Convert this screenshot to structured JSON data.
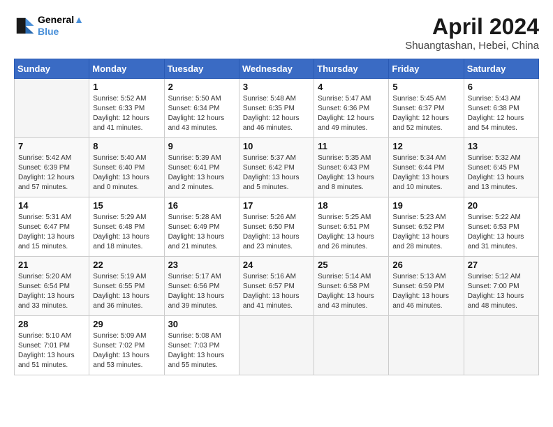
{
  "header": {
    "logo_line1": "General",
    "logo_line2": "Blue",
    "month_title": "April 2024",
    "subtitle": "Shuangtashan, Hebei, China"
  },
  "weekdays": [
    "Sunday",
    "Monday",
    "Tuesday",
    "Wednesday",
    "Thursday",
    "Friday",
    "Saturday"
  ],
  "weeks": [
    [
      {
        "day": "",
        "info": ""
      },
      {
        "day": "1",
        "info": "Sunrise: 5:52 AM\nSunset: 6:33 PM\nDaylight: 12 hours\nand 41 minutes."
      },
      {
        "day": "2",
        "info": "Sunrise: 5:50 AM\nSunset: 6:34 PM\nDaylight: 12 hours\nand 43 minutes."
      },
      {
        "day": "3",
        "info": "Sunrise: 5:48 AM\nSunset: 6:35 PM\nDaylight: 12 hours\nand 46 minutes."
      },
      {
        "day": "4",
        "info": "Sunrise: 5:47 AM\nSunset: 6:36 PM\nDaylight: 12 hours\nand 49 minutes."
      },
      {
        "day": "5",
        "info": "Sunrise: 5:45 AM\nSunset: 6:37 PM\nDaylight: 12 hours\nand 52 minutes."
      },
      {
        "day": "6",
        "info": "Sunrise: 5:43 AM\nSunset: 6:38 PM\nDaylight: 12 hours\nand 54 minutes."
      }
    ],
    [
      {
        "day": "7",
        "info": "Sunrise: 5:42 AM\nSunset: 6:39 PM\nDaylight: 12 hours\nand 57 minutes."
      },
      {
        "day": "8",
        "info": "Sunrise: 5:40 AM\nSunset: 6:40 PM\nDaylight: 13 hours\nand 0 minutes."
      },
      {
        "day": "9",
        "info": "Sunrise: 5:39 AM\nSunset: 6:41 PM\nDaylight: 13 hours\nand 2 minutes."
      },
      {
        "day": "10",
        "info": "Sunrise: 5:37 AM\nSunset: 6:42 PM\nDaylight: 13 hours\nand 5 minutes."
      },
      {
        "day": "11",
        "info": "Sunrise: 5:35 AM\nSunset: 6:43 PM\nDaylight: 13 hours\nand 8 minutes."
      },
      {
        "day": "12",
        "info": "Sunrise: 5:34 AM\nSunset: 6:44 PM\nDaylight: 13 hours\nand 10 minutes."
      },
      {
        "day": "13",
        "info": "Sunrise: 5:32 AM\nSunset: 6:45 PM\nDaylight: 13 hours\nand 13 minutes."
      }
    ],
    [
      {
        "day": "14",
        "info": "Sunrise: 5:31 AM\nSunset: 6:47 PM\nDaylight: 13 hours\nand 15 minutes."
      },
      {
        "day": "15",
        "info": "Sunrise: 5:29 AM\nSunset: 6:48 PM\nDaylight: 13 hours\nand 18 minutes."
      },
      {
        "day": "16",
        "info": "Sunrise: 5:28 AM\nSunset: 6:49 PM\nDaylight: 13 hours\nand 21 minutes."
      },
      {
        "day": "17",
        "info": "Sunrise: 5:26 AM\nSunset: 6:50 PM\nDaylight: 13 hours\nand 23 minutes."
      },
      {
        "day": "18",
        "info": "Sunrise: 5:25 AM\nSunset: 6:51 PM\nDaylight: 13 hours\nand 26 minutes."
      },
      {
        "day": "19",
        "info": "Sunrise: 5:23 AM\nSunset: 6:52 PM\nDaylight: 13 hours\nand 28 minutes."
      },
      {
        "day": "20",
        "info": "Sunrise: 5:22 AM\nSunset: 6:53 PM\nDaylight: 13 hours\nand 31 minutes."
      }
    ],
    [
      {
        "day": "21",
        "info": "Sunrise: 5:20 AM\nSunset: 6:54 PM\nDaylight: 13 hours\nand 33 minutes."
      },
      {
        "day": "22",
        "info": "Sunrise: 5:19 AM\nSunset: 6:55 PM\nDaylight: 13 hours\nand 36 minutes."
      },
      {
        "day": "23",
        "info": "Sunrise: 5:17 AM\nSunset: 6:56 PM\nDaylight: 13 hours\nand 39 minutes."
      },
      {
        "day": "24",
        "info": "Sunrise: 5:16 AM\nSunset: 6:57 PM\nDaylight: 13 hours\nand 41 minutes."
      },
      {
        "day": "25",
        "info": "Sunrise: 5:14 AM\nSunset: 6:58 PM\nDaylight: 13 hours\nand 43 minutes."
      },
      {
        "day": "26",
        "info": "Sunrise: 5:13 AM\nSunset: 6:59 PM\nDaylight: 13 hours\nand 46 minutes."
      },
      {
        "day": "27",
        "info": "Sunrise: 5:12 AM\nSunset: 7:00 PM\nDaylight: 13 hours\nand 48 minutes."
      }
    ],
    [
      {
        "day": "28",
        "info": "Sunrise: 5:10 AM\nSunset: 7:01 PM\nDaylight: 13 hours\nand 51 minutes."
      },
      {
        "day": "29",
        "info": "Sunrise: 5:09 AM\nSunset: 7:02 PM\nDaylight: 13 hours\nand 53 minutes."
      },
      {
        "day": "30",
        "info": "Sunrise: 5:08 AM\nSunset: 7:03 PM\nDaylight: 13 hours\nand 55 minutes."
      },
      {
        "day": "",
        "info": ""
      },
      {
        "day": "",
        "info": ""
      },
      {
        "day": "",
        "info": ""
      },
      {
        "day": "",
        "info": ""
      }
    ]
  ]
}
